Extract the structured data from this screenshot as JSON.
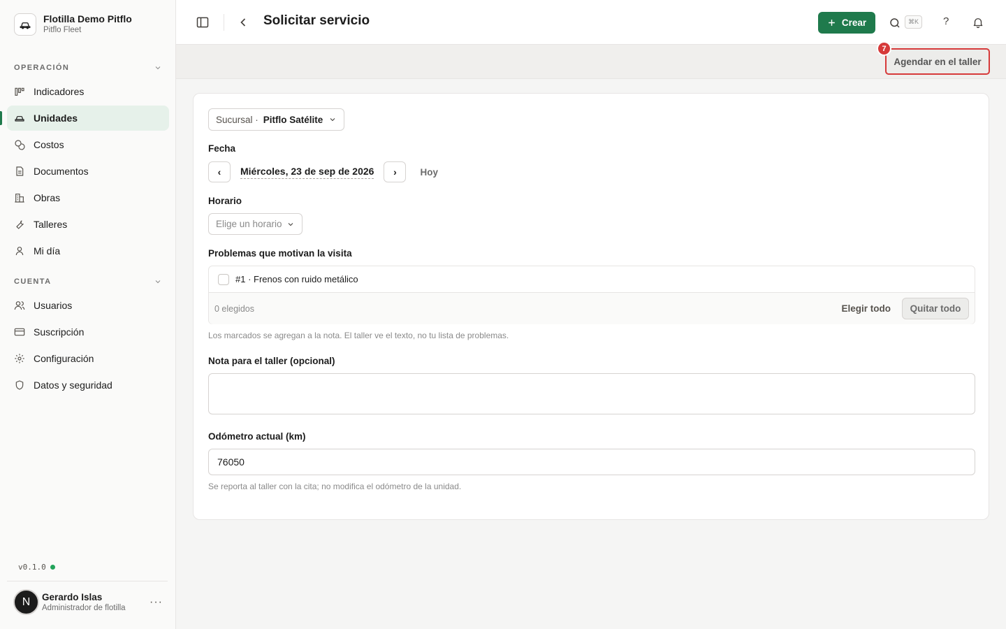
{
  "org": {
    "name": "Flotilla Demo Pitflo",
    "sub": "Pitflo Fleet"
  },
  "sidebar": {
    "section_operation": "OPERACIÓN",
    "operation_items": [
      {
        "label": "Indicadores",
        "icon": "chart-bars-icon"
      },
      {
        "label": "Unidades",
        "icon": "car-icon",
        "active": true
      },
      {
        "label": "Costos",
        "icon": "coins-icon"
      },
      {
        "label": "Documentos",
        "icon": "document-icon"
      },
      {
        "label": "Obras",
        "icon": "building-icon"
      },
      {
        "label": "Talleres",
        "icon": "wrench-icon"
      },
      {
        "label": "Mi día",
        "icon": "user-icon"
      }
    ],
    "section_account": "CUENTA",
    "account_items": [
      {
        "label": "Usuarios",
        "icon": "users-icon"
      },
      {
        "label": "Suscripción",
        "icon": "card-icon"
      },
      {
        "label": "Configuración",
        "icon": "gear-icon"
      },
      {
        "label": "Datos y seguridad",
        "icon": "shield-icon"
      }
    ],
    "version": "v0.1.0",
    "user": {
      "initial": "N",
      "name": "Gerardo Islas",
      "role": "Administrador de flotilla",
      "more": "···"
    }
  },
  "topbar": {
    "title": "Solicitar servicio",
    "create_label": "Crear",
    "shortcut": "⌘K",
    "help": "?"
  },
  "strip": {
    "schedule_label": "Agendar en el taller",
    "badge": "7"
  },
  "form": {
    "branch_prefix": "Sucursal ·",
    "branch_value": "Pitflo Satélite",
    "date_label": "Fecha",
    "date_prev": "‹",
    "date_value": "Miércoles, 23 de sep de 2026",
    "date_next": "›",
    "today": "Hoy",
    "schedule_label": "Horario",
    "schedule_placeholder": "Elige un horario",
    "problems_label": "Problemas que motivan la visita",
    "problems": [
      {
        "text": "#1 · Frenos con ruido metálico",
        "checked": false
      }
    ],
    "chosen_count": "0 elegidos",
    "select_all": "Elegir todo",
    "clear_all": "Quitar todo",
    "problems_hint": "Los marcados se agregan a la nota. El taller ve el texto, no tu lista de problemas.",
    "note_label": "Nota para el taller (opcional)",
    "note_value": "",
    "odometer_label": "Odómetro actual (km)",
    "odometer_value": "76050",
    "odometer_hint": "Se reporta al taller con la cita; no modifica el odómetro de la unidad."
  },
  "colors": {
    "brand": "#1f7a4c",
    "highlight": "#d63a3a",
    "active_bg": "#e6f1ea"
  }
}
